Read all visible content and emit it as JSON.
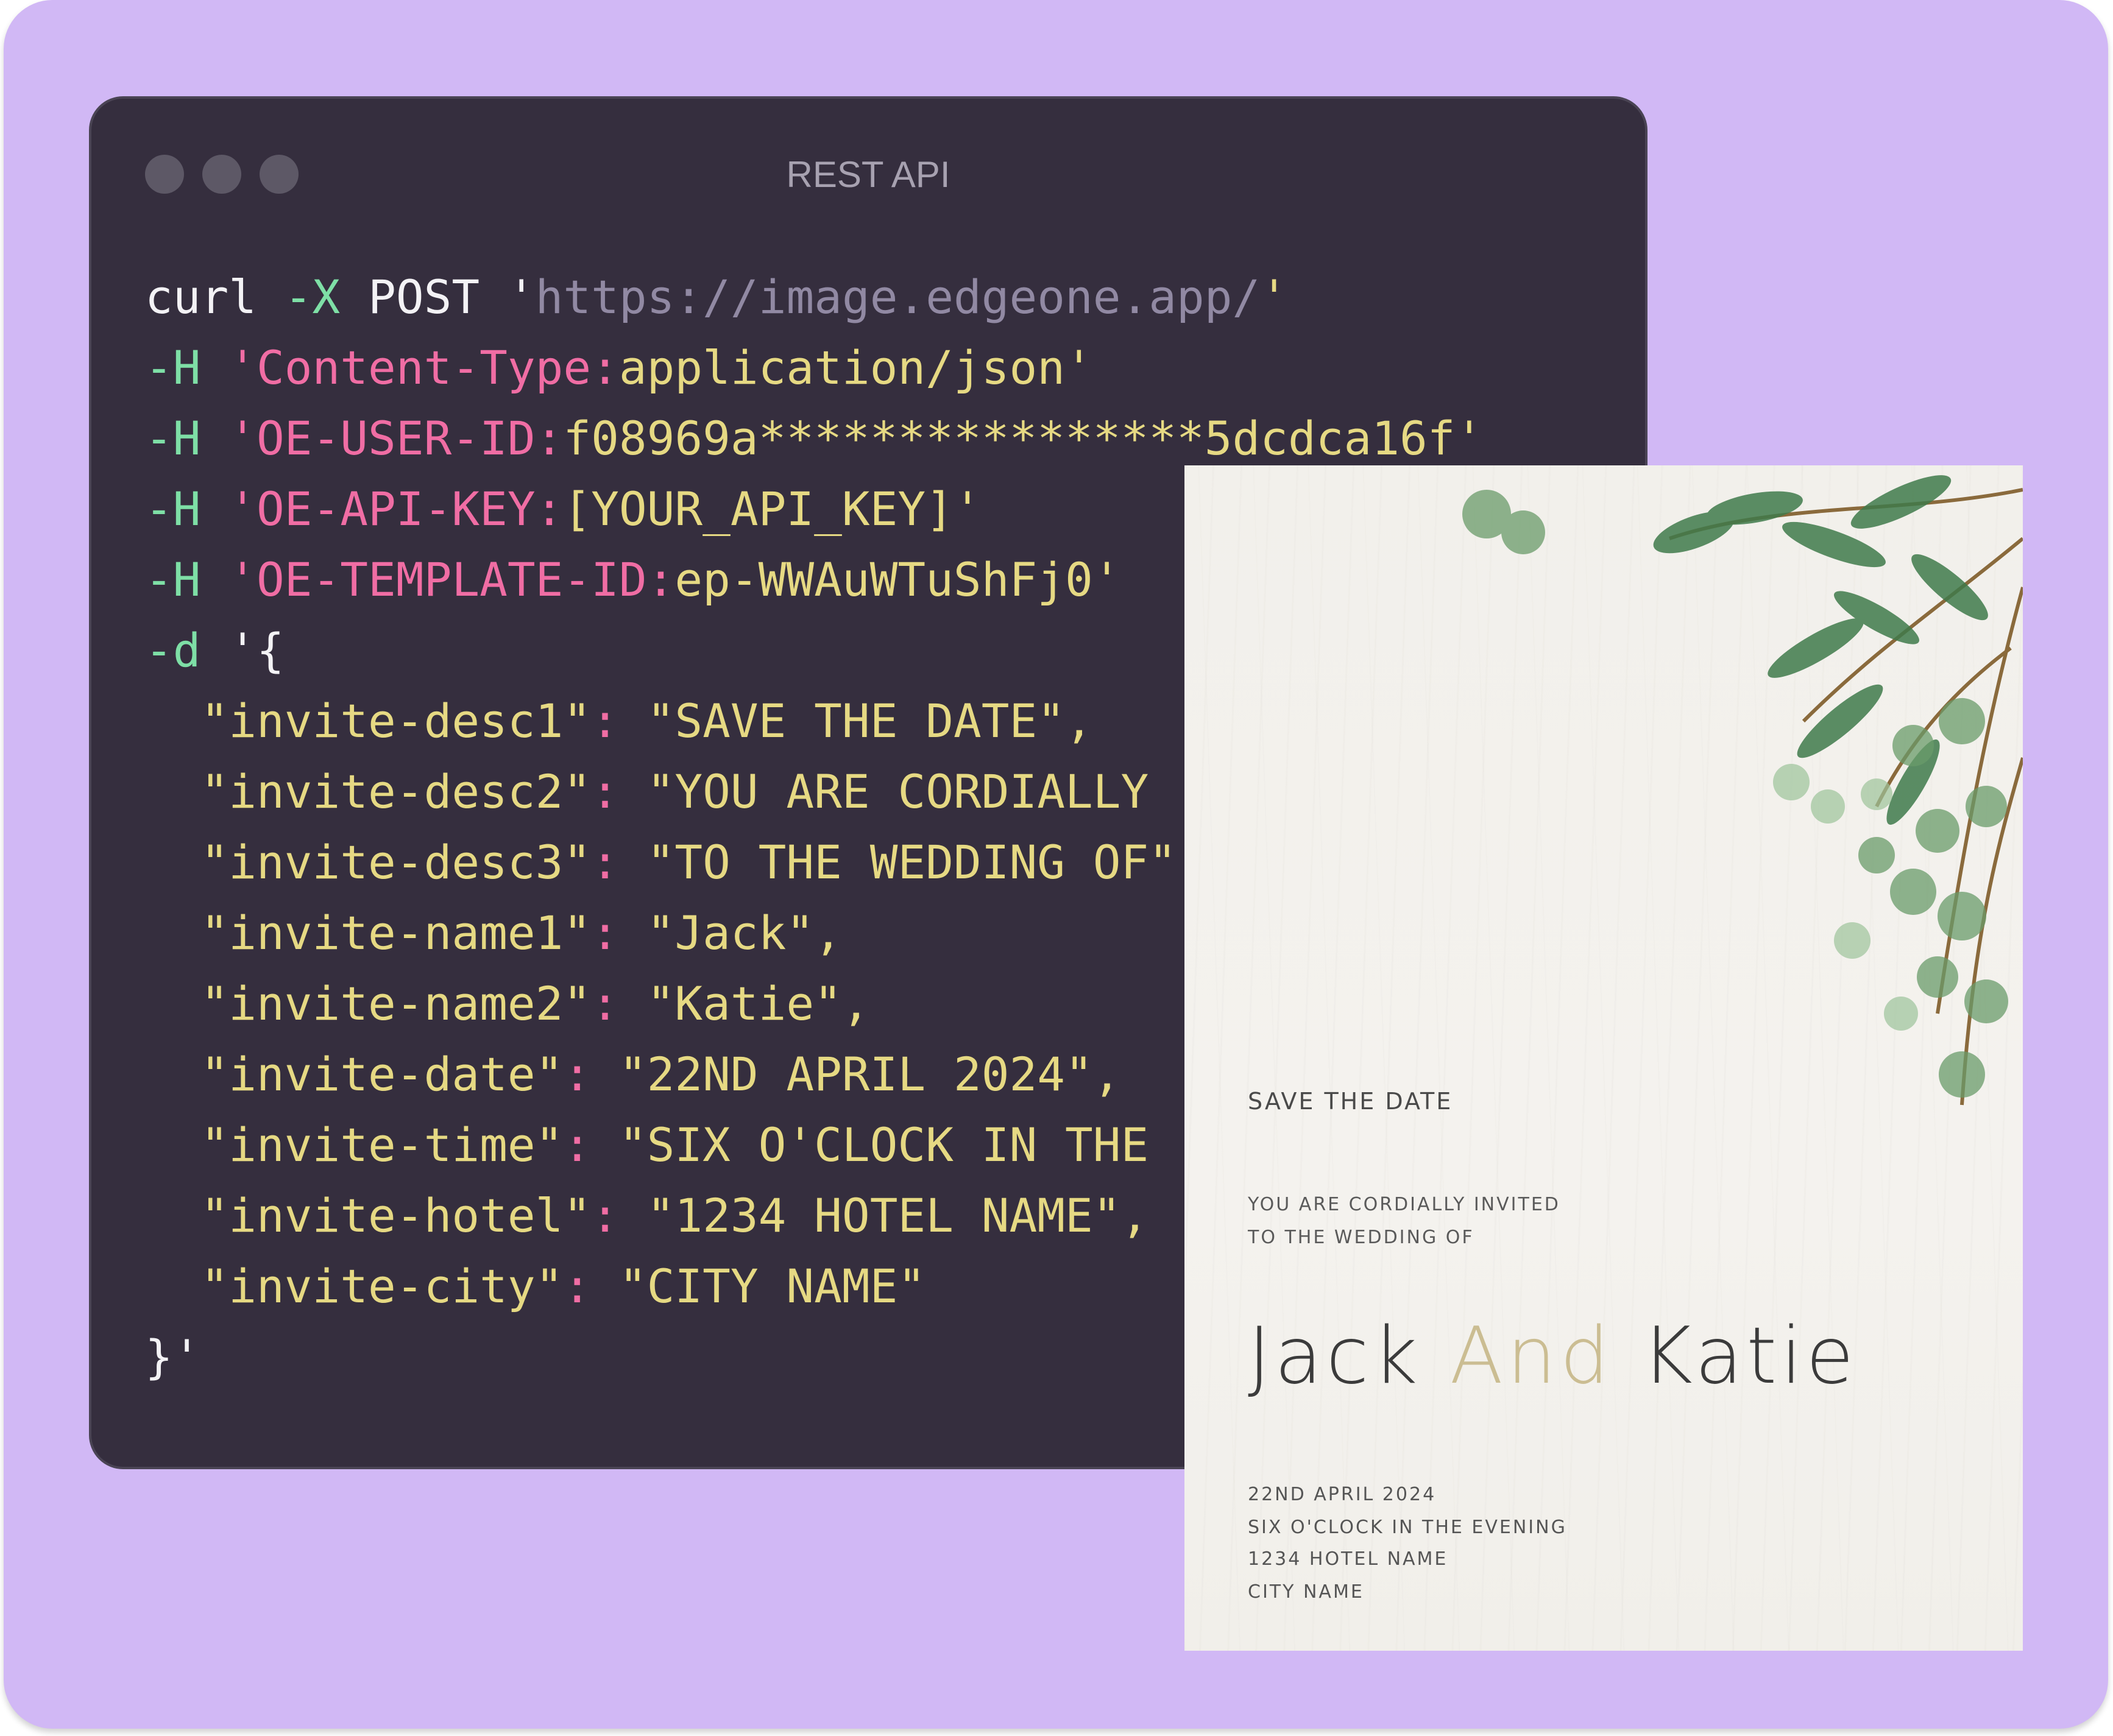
{
  "window": {
    "title": "REST API"
  },
  "code": {
    "line1": {
      "cmd": "curl",
      "flag": "-X",
      "method": "POST",
      "quote": "'",
      "url": "https://image.edgeone.app/",
      "endquote": "'"
    },
    "headers": [
      {
        "flag": "-H",
        "key": "'Content-Type:",
        "value": "application/json'"
      },
      {
        "flag": "-H",
        "key": "'OE-USER-ID:",
        "value": "f08969a****************5dcdca16f'"
      },
      {
        "flag": "-H",
        "key": "'OE-API-KEY:",
        "value": "[YOUR_API_KEY]'"
      },
      {
        "flag": "-H",
        "key": "'OE-TEMPLATE-ID:",
        "value": "ep-WWAuWTuShFj0'"
      }
    ],
    "data_flag": "-d",
    "data_open": "'{",
    "fields": [
      {
        "key": "\"invite-desc1\"",
        "value": "\"SAVE THE DATE\","
      },
      {
        "key": "\"invite-desc2\"",
        "value": "\"YOU ARE CORDIALLY"
      },
      {
        "key": "\"invite-desc3\"",
        "value": "\"TO THE WEDDING OF\""
      },
      {
        "key": "\"invite-name1\"",
        "value": "\"Jack\","
      },
      {
        "key": "\"invite-name2\"",
        "value": "\"Katie\","
      },
      {
        "key": "\"invite-date\"",
        "value": "\"22ND APRIL 2024\","
      },
      {
        "key": "\"invite-time\"",
        "value": "\"SIX O'CLOCK IN THE"
      },
      {
        "key": "\"invite-hotel\"",
        "value": "\"1234 HOTEL NAME\","
      },
      {
        "key": "\"invite-city\"",
        "value": "\"CITY NAME\""
      }
    ],
    "data_close": "}'"
  },
  "card": {
    "save_the_date": "SAVE THE DATE",
    "invite_line1": "YOU ARE CORDIALLY INVITED",
    "invite_line2": "TO THE WEDDING OF",
    "name1": "Jack",
    "and": "And",
    "name2": "Katie",
    "date": "22ND APRIL 2024",
    "time": "SIX O'CLOCK IN THE EVENING",
    "hotel": "1234 HOTEL NAME",
    "city": "CITY NAME"
  },
  "colors": {
    "background": "#d1b8f5",
    "window": "#352e3e",
    "pink": "#f06da4",
    "green": "#7edfa6",
    "yellow": "#e6d983",
    "gold": "#cbbd92"
  }
}
